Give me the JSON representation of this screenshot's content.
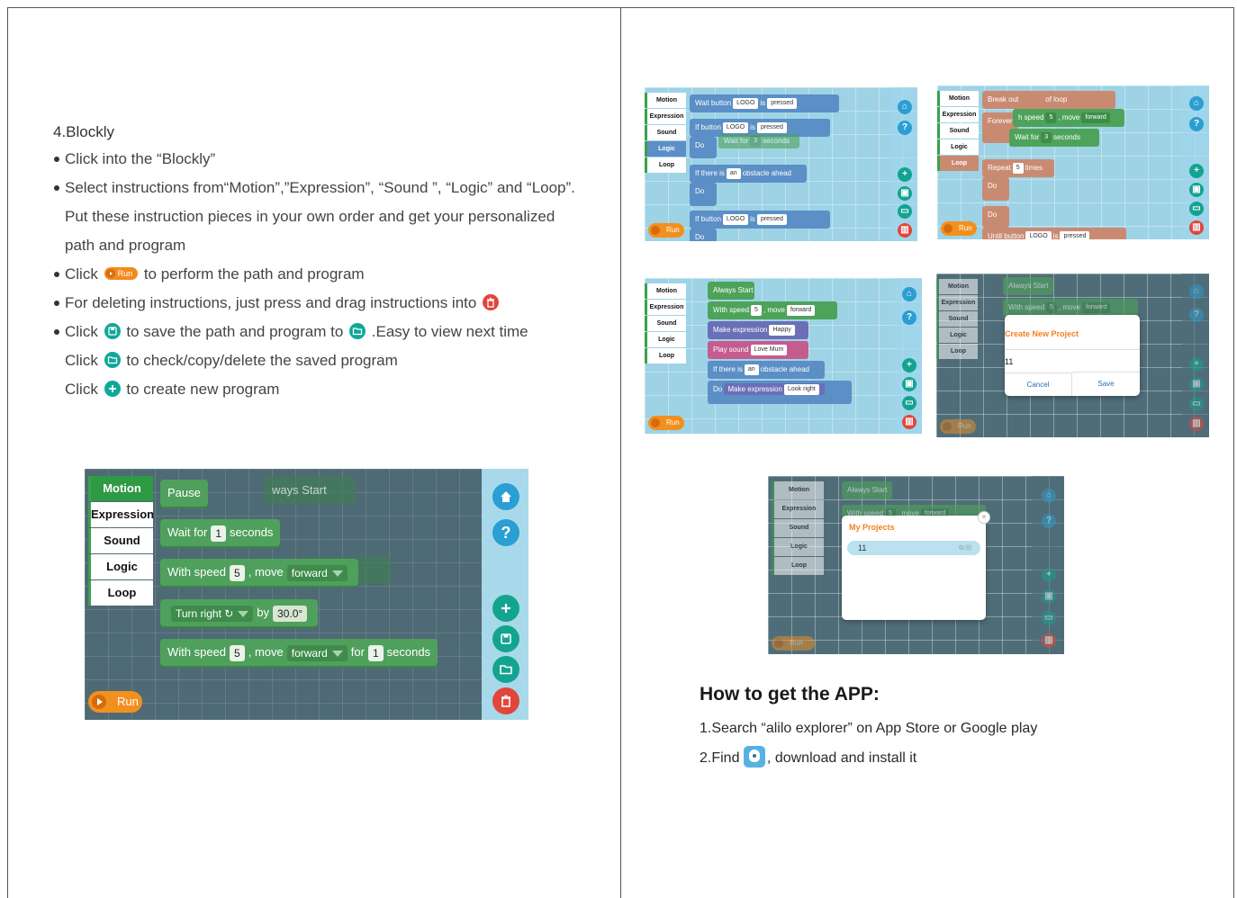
{
  "left": {
    "section_title": "4.Blockly",
    "steps": {
      "s1": "Click into the “Blockly”",
      "s2": "Select instructions from“Motion”,”Expression”, “Sound ”, “Logic” and “Loop”. Put these instruction pieces in your own order and get your personalized path and program",
      "s3_a": "Click",
      "s3_pill": "Run",
      "s3_b": "to perform the path and program",
      "s4": "For deleting instructions, just press and drag instructions into",
      "s5_a": "Click",
      "s5_b": "to save the path and program to",
      "s5_c": ".Easy to view next time",
      "s6_a": "Click",
      "s6_b": "to check/copy/delete the saved program",
      "s7_a": "Click",
      "s7_b": "to create new program"
    },
    "big_screenshot": {
      "categories": [
        "Motion",
        "Expression",
        "Sound",
        "Logic",
        "Loop"
      ],
      "blocks": {
        "pause": "Pause",
        "ghost_start": "ways Start",
        "wait_label": "Wait for",
        "wait_value": "1",
        "wait_unit": "seconds",
        "speed_label": "With speed",
        "speed_value": "5",
        "move_label": ", move",
        "move_value": "forward",
        "turn_value": "Turn right ↻",
        "by_label": "by",
        "angle_value": "30.0°",
        "speed2_label": "With speed",
        "speed2_value": "5",
        "move2_label": ", move",
        "move2_value": "forward",
        "for_label": "for",
        "for_value": "1",
        "for_unit": "seconds"
      },
      "run_label": "Run",
      "help_glyph": "?"
    }
  },
  "right": {
    "shot1": {
      "categories": [
        "Motion",
        "Expression",
        "Sound",
        "Logic",
        "Loop"
      ],
      "b1_label": "Wait button",
      "b1_f1": "LOGO",
      "b1_is": "is",
      "b1_f2": "pressed",
      "b2_label": "If button",
      "b2_f1": "LOGO",
      "b2_is": "is",
      "b2_f2": "pressed",
      "b2_do": "Do",
      "b2_ghost": "Wait for",
      "b2_ghost_val": "3",
      "b2_ghost_unit": "seconds",
      "b3_label": "If there is",
      "b3_f1": "an",
      "b3_rest": "obstacle ahead",
      "b3_do": "Do",
      "b4_label": "If button",
      "b4_f1": "LOGO",
      "b4_is": "is",
      "b4_f2": "pressed",
      "b4_do": "Do",
      "run_label": "Run"
    },
    "shot2": {
      "categories": [
        "Motion",
        "Expression",
        "Sound",
        "Logic",
        "Loop"
      ],
      "b1_label": "Break out",
      "b1_rest": "of loop",
      "b2_label": "Forever",
      "b2_tail": "h speed",
      "b2_val": "5",
      "b2_move": ", move",
      "b2_dir": "forward",
      "b3_label": "Wait for",
      "b3_val": "3",
      "b3_unit": "seconds",
      "b4_label": "Repeat",
      "b4_val": "5",
      "b4_unit": "times",
      "b4_do": "Do",
      "b5_do": "Do",
      "b6_label": "Until button",
      "b6_f1": "LOGO",
      "b6_is": "is",
      "b6_f2": "pressed",
      "run_label": "Run"
    },
    "shot3": {
      "categories": [
        "Motion",
        "Expression",
        "Sound",
        "Logic",
        "Loop"
      ],
      "b1_label": "Always Start",
      "b2_label": "With speed",
      "b2_val": "5",
      "b2_move": ", move",
      "b2_dir": "forward",
      "b3_label": "Make expression",
      "b3_val": "Happy",
      "b4_label": "Play sound",
      "b4_val": "Love Mum",
      "b5_label": "If there is",
      "b5_f1": "an",
      "b5_rest": "obstacle ahead",
      "b6_do": "Do",
      "b6_label": "Make expression",
      "b6_val": "Look right",
      "run_label": "Run"
    },
    "shot4": {
      "categories": [
        "Motion",
        "Expression",
        "Sound",
        "Logic",
        "Loop"
      ],
      "b1_label": "Always Start",
      "b2_label": "With speed",
      "b2_val": "5",
      "b2_move": ", move",
      "b2_dir": "forward",
      "dialog_title": "Create New Project",
      "dialog_value": "11",
      "cancel_label": "Cancel",
      "save_label": "Save",
      "run_label": "Run"
    },
    "shot5": {
      "categories": [
        "Motion",
        "Expression",
        "Sound",
        "Logic",
        "Loop"
      ],
      "b1_label": "Always Start",
      "b2_label": "With speed",
      "b2_val": "5",
      "b2_move": ", move",
      "b2_dir": "forward",
      "dialog_title": "My Projects",
      "project_name": "11",
      "run_label": "Run"
    },
    "howto": {
      "title": "How to get the APP:",
      "line1": "1.Search “alilo explorer” on App Store or Google play",
      "line2_a": "2.Find",
      "line2_b": ", download and install it"
    }
  },
  "colors": {
    "accent_orange": "#f2901f",
    "block_green": "#4ea35a",
    "teal_button": "#13a490",
    "delete_red": "#e2463b"
  }
}
